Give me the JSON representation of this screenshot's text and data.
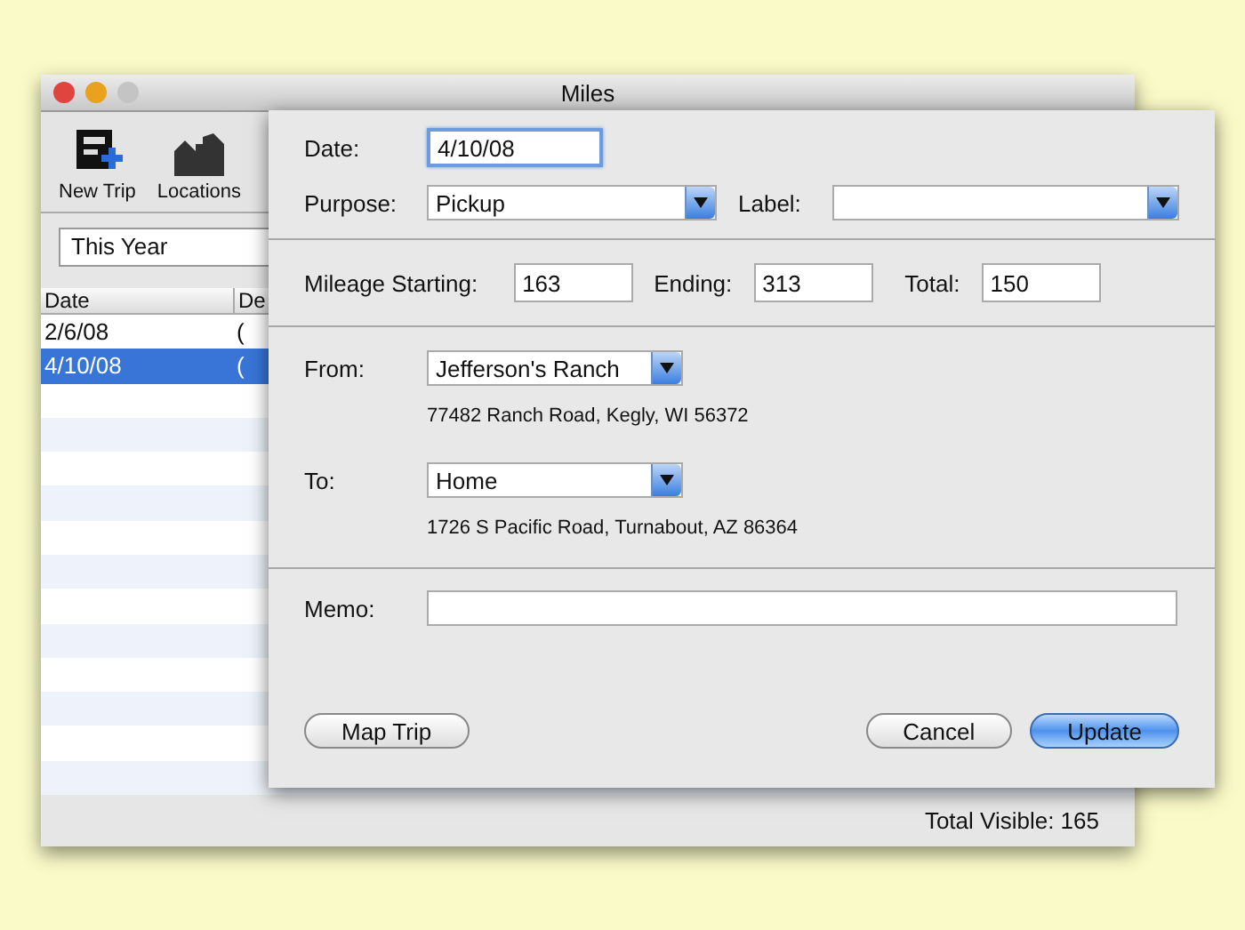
{
  "window": {
    "title": "Miles"
  },
  "toolbar": [
    {
      "label": "New Trip",
      "kind": "new-trip"
    },
    {
      "label": "Locations",
      "kind": "locations"
    }
  ],
  "filter": {
    "value": "This Year"
  },
  "table": {
    "columns": [
      "Date",
      "De"
    ],
    "rows": [
      {
        "cells": [
          "2/6/08",
          "("
        ],
        "selected": false
      },
      {
        "cells": [
          "4/10/08",
          "("
        ],
        "selected": true
      }
    ]
  },
  "status_bar": "Total Visible: 165",
  "sheet": {
    "date": {
      "label": "Date:",
      "value": "4/10/08",
      "focused": true
    },
    "purpose": {
      "label": "Purpose:",
      "value": "Pickup"
    },
    "label_field": {
      "label": "Label:"
    },
    "mileage": [
      {
        "label": "Mileage Starting:",
        "value": "163"
      },
      {
        "label": "Ending:",
        "value": "313"
      },
      {
        "label": "Total:",
        "value": "150"
      }
    ],
    "from": {
      "label": "From:",
      "value": "Jefferson's Ranch",
      "address": "77482 Ranch Road, Kegly, WI 56372"
    },
    "to": {
      "label": "To:",
      "value": "Home",
      "address": "1726 S Pacific Road, Turnabout, AZ 86364"
    },
    "memo": {
      "label": "Memo:"
    },
    "buttons_left": [
      {
        "label": "Map Trip",
        "default": false
      }
    ],
    "buttons_right": [
      {
        "label": "Cancel",
        "default": false
      },
      {
        "label": "Update",
        "default": true
      }
    ]
  }
}
